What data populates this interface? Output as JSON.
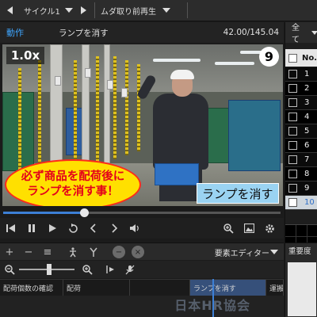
{
  "topbar": {
    "cycle_label": "サイクル1",
    "filter_label": "ムダ取り前再生"
  },
  "action": {
    "label": "動作",
    "name": "ランプを消す",
    "time": "42.00/145.04"
  },
  "video": {
    "speed": "1.0x",
    "step_number": "9",
    "warning_line1": "必ず商品を配荷後に",
    "warning_line2": "ランプを消す事！",
    "caption": "ランプを消す",
    "progress": 0.29
  },
  "editor": {
    "label": "要素エディター"
  },
  "timeline": {
    "cells": [
      "配荷個数の確認",
      "配荷",
      "",
      "ランプを消す",
      "運搬"
    ],
    "watermark": "日本HR協会"
  },
  "right_panel": {
    "filter": "全て",
    "column_header": "No.",
    "rows": [
      "1",
      "2",
      "3",
      "4",
      "5",
      "6",
      "7",
      "8",
      "9",
      "10"
    ],
    "selected_row": "10",
    "bottom_label": "重要度"
  },
  "icons": {
    "zoom_in": "magnifier-plus-icon",
    "zoom_out": "magnifier-minus-icon"
  },
  "colors": {
    "accent": "#3d80d6",
    "warning_fill": "#ffe000",
    "warning_text": "#e4001b",
    "caption_bg": "#9ad3f2"
  }
}
